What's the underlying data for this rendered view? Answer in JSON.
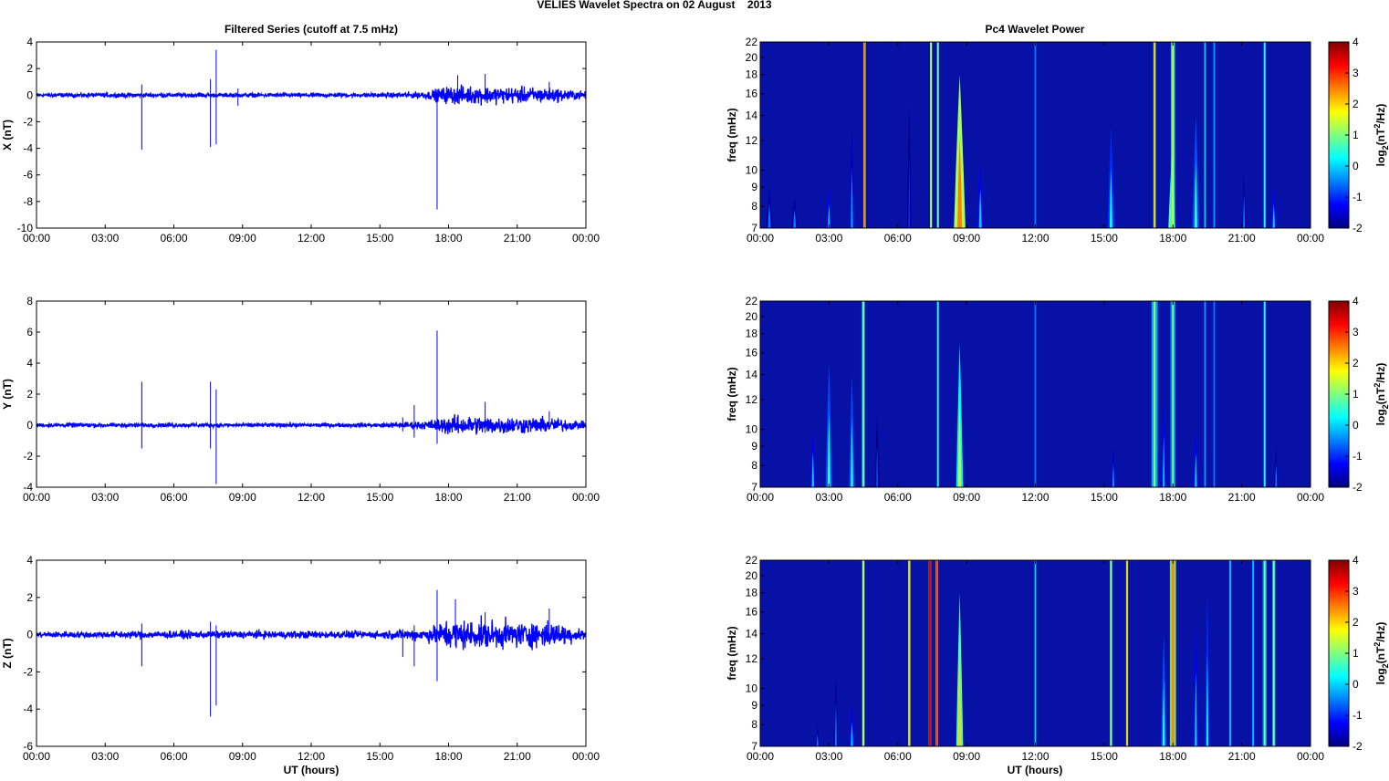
{
  "chart_data": {
    "type": "line+heatmap",
    "title": "VELIES Wavelet Spectra on 02 August    2013",
    "left_title": "Filtered Series (cutoff at 7.5 mHz)",
    "right_title": "Pc4 Wavelet Power",
    "xlabel": "UT (hours)",
    "time_ticks": [
      "00:00",
      "03:00",
      "06:00",
      "09:00",
      "12:00",
      "15:00",
      "18:00",
      "21:00",
      "00:00"
    ],
    "xlim_hours": [
      0,
      24
    ],
    "timeseries": [
      {
        "ylabel": "X (nT)",
        "ylim": [
          -10,
          4
        ],
        "yticks": [
          -10,
          -8,
          -6,
          -4,
          -2,
          0,
          2,
          4
        ],
        "spikes": [
          [
            4.6,
            -4.1,
            0.8
          ],
          [
            7.6,
            -3.9,
            1.2
          ],
          [
            7.85,
            -3.7,
            3.4
          ],
          [
            8.8,
            -0.8,
            0.5
          ],
          [
            17.5,
            -8.6,
            0.3
          ],
          [
            18.4,
            -0.6,
            1.5
          ],
          [
            19.6,
            -0.5,
            1.6
          ],
          [
            22.4,
            -0.4,
            1.0
          ]
        ],
        "noise": [
          [
            0,
            0.12
          ],
          [
            6,
            0.12
          ],
          [
            15,
            0.12
          ],
          [
            17,
            0.2
          ],
          [
            18,
            0.5
          ],
          [
            21,
            0.45
          ],
          [
            22.5,
            0.4
          ],
          [
            24,
            0.2
          ]
        ]
      },
      {
        "ylabel": "Y (nT)",
        "ylim": [
          -4,
          8
        ],
        "yticks": [
          -4,
          -2,
          0,
          2,
          4,
          6,
          8
        ],
        "spikes": [
          [
            4.6,
            -1.5,
            2.8
          ],
          [
            7.6,
            -1.5,
            2.8
          ],
          [
            7.85,
            -3.8,
            2.3
          ],
          [
            16.0,
            -0.4,
            0.5
          ],
          [
            16.5,
            -0.8,
            1.3
          ],
          [
            17.5,
            -1.2,
            6.1
          ],
          [
            19.6,
            -0.5,
            1.5
          ],
          [
            22.4,
            -0.3,
            0.9
          ]
        ],
        "noise": [
          [
            0,
            0.1
          ],
          [
            6,
            0.1
          ],
          [
            15,
            0.1
          ],
          [
            17,
            0.2
          ],
          [
            18,
            0.45
          ],
          [
            21,
            0.4
          ],
          [
            22.5,
            0.35
          ],
          [
            24,
            0.15
          ]
        ]
      },
      {
        "ylabel": "Z (nT)",
        "ylim": [
          -6,
          4
        ],
        "yticks": [
          -6,
          -4,
          -2,
          0,
          2,
          4
        ],
        "spikes": [
          [
            4.6,
            -1.7,
            0.6
          ],
          [
            7.6,
            -4.4,
            0.7
          ],
          [
            7.85,
            -3.8,
            0.5
          ],
          [
            16.0,
            -1.2,
            0.3
          ],
          [
            16.5,
            -1.7,
            0.5
          ],
          [
            17.5,
            -2.5,
            2.4
          ],
          [
            18.3,
            -0.6,
            1.9
          ],
          [
            19.6,
            -0.5,
            1.2
          ],
          [
            22.4,
            -0.4,
            1.4
          ]
        ],
        "noise": [
          [
            0,
            0.12
          ],
          [
            6,
            0.15
          ],
          [
            15,
            0.15
          ],
          [
            17,
            0.25
          ],
          [
            18,
            0.6
          ],
          [
            21,
            0.5
          ],
          [
            22.5,
            0.5
          ],
          [
            24,
            0.2
          ]
        ]
      }
    ],
    "spectra": [
      {
        "ylabel": "freq (mHz)",
        "ylim": [
          7,
          22
        ],
        "yscale": "log",
        "yticks": [
          7,
          8,
          9,
          10,
          12,
          14,
          16,
          18,
          20,
          22
        ],
        "streaks": [
          [
            0.4,
            9,
            -0.5,
            0.15
          ],
          [
            1.5,
            8.5,
            -0.5,
            0.15
          ],
          [
            3.0,
            9,
            0,
            0.12
          ],
          [
            4.0,
            13,
            -0.3,
            0.12
          ],
          [
            4.55,
            22,
            2.5,
            0.06
          ],
          [
            6.5,
            15,
            -1,
            0.1
          ],
          [
            7.45,
            22,
            1.5,
            0.05
          ],
          [
            7.75,
            22,
            1,
            0.05
          ],
          [
            8.7,
            18,
            2.5,
            0.25
          ],
          [
            9.6,
            10.5,
            0,
            0.15
          ],
          [
            12,
            22,
            -0.5,
            0.05
          ],
          [
            15.3,
            13,
            0.3,
            0.15
          ],
          [
            17.2,
            22,
            2,
            0.06
          ],
          [
            17.95,
            11,
            2,
            0.15
          ],
          [
            18.0,
            22,
            1.5,
            0.1
          ],
          [
            19.0,
            14,
            0.5,
            0.15
          ],
          [
            19.4,
            22,
            0,
            0.06
          ],
          [
            19.8,
            22,
            -0.3,
            0.06
          ],
          [
            21.1,
            10,
            -0.5,
            0.1
          ],
          [
            22.0,
            22,
            0.5,
            0.06
          ],
          [
            22.4,
            9,
            0,
            0.12
          ]
        ]
      },
      {
        "ylabel": "freq (mHz)",
        "ylim": [
          7,
          22
        ],
        "yscale": "log",
        "yticks": [
          7,
          8,
          9,
          10,
          12,
          14,
          16,
          18,
          20,
          22
        ],
        "streaks": [
          [
            2.3,
            10,
            0,
            0.12
          ],
          [
            3.0,
            15,
            0.5,
            0.15
          ],
          [
            4.0,
            14,
            0.5,
            0.12
          ],
          [
            4.5,
            22,
            1,
            0.08
          ],
          [
            5.1,
            11,
            -0.8,
            0.1
          ],
          [
            7.75,
            22,
            0.5,
            0.05
          ],
          [
            8.7,
            17,
            1.5,
            0.15
          ],
          [
            12,
            22,
            -0.5,
            0.05
          ],
          [
            15.4,
            9,
            -0.3,
            0.1
          ],
          [
            17.2,
            22,
            1.2,
            0.15
          ],
          [
            17.6,
            12,
            0,
            0.1
          ],
          [
            18.0,
            22,
            1,
            0.12
          ],
          [
            19.0,
            10,
            0,
            0.12
          ],
          [
            19.4,
            22,
            -0.3,
            0.08
          ],
          [
            19.8,
            22,
            -0.5,
            0.06
          ],
          [
            22.0,
            22,
            0.5,
            0.06
          ],
          [
            22.5,
            9,
            -0.5,
            0.1
          ]
        ]
      },
      {
        "ylabel": "freq (mHz)",
        "ylim": [
          7,
          22
        ],
        "yscale": "log",
        "yticks": [
          7,
          8,
          9,
          10,
          12,
          14,
          16,
          18,
          20,
          22
        ],
        "streaks": [
          [
            2.5,
            8,
            -0.5,
            0.1
          ],
          [
            3.3,
            11,
            -0.5,
            0.1
          ],
          [
            4.0,
            9,
            0,
            0.12
          ],
          [
            4.5,
            22,
            1.5,
            0.06
          ],
          [
            6.5,
            22,
            2,
            0.06
          ],
          [
            7.4,
            22,
            3.5,
            0.06
          ],
          [
            7.7,
            22,
            3,
            0.06
          ],
          [
            8.7,
            18,
            2,
            0.15
          ],
          [
            12,
            22,
            0,
            0.05
          ],
          [
            15.3,
            22,
            1.2,
            0.06
          ],
          [
            16.0,
            22,
            2,
            0.05
          ],
          [
            17.6,
            14,
            0.5,
            0.12
          ],
          [
            18.0,
            22,
            2.5,
            0.15
          ],
          [
            19.0,
            15,
            0,
            0.12
          ],
          [
            19.5,
            18,
            0.3,
            0.1
          ],
          [
            20.5,
            22,
            0,
            0.08
          ],
          [
            21.5,
            22,
            0,
            0.08
          ],
          [
            22.0,
            22,
            1,
            0.1
          ],
          [
            22.4,
            22,
            1,
            0.08
          ]
        ]
      }
    ],
    "colorbar": {
      "range": [
        -2,
        4
      ],
      "ticks": [
        -2,
        -1,
        0,
        1,
        2,
        3,
        4
      ],
      "colormap": "jet",
      "label_parts": [
        "log",
        "2",
        "(nT",
        "2",
        "/Hz)"
      ]
    },
    "colors": {
      "series": "#0000ff",
      "spectrum_background": "#0811a6"
    }
  }
}
